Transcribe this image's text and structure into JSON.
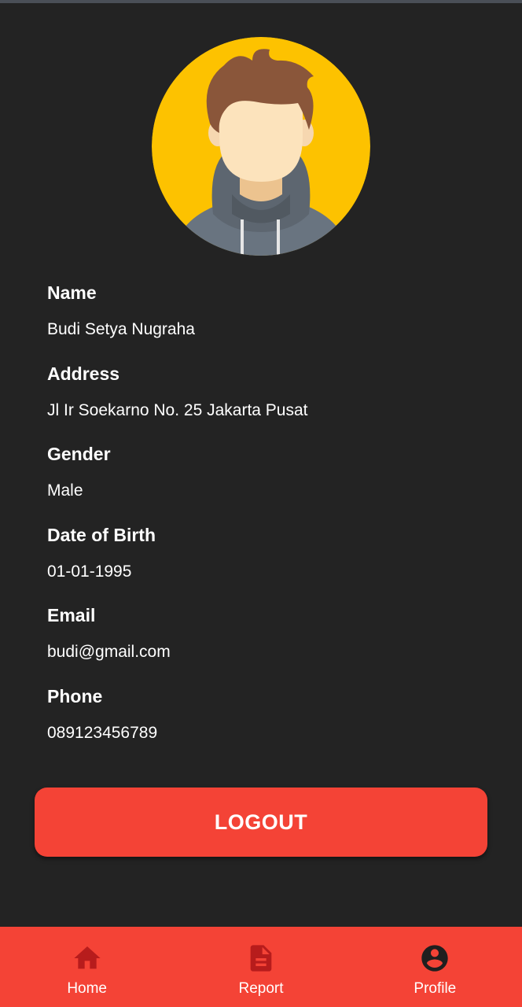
{
  "profile": {
    "fields": [
      {
        "label": "Name",
        "value": "Budi Setya Nugraha"
      },
      {
        "label": "Address",
        "value": "Jl Ir Soekarno No. 25 Jakarta Pusat"
      },
      {
        "label": "Gender",
        "value": "Male"
      },
      {
        "label": "Date of Birth",
        "value": "01-01-1995"
      },
      {
        "label": "Email",
        "value": "budi@gmail.com"
      },
      {
        "label": "Phone",
        "value": "089123456789"
      }
    ]
  },
  "actions": {
    "logout_label": "LOGOUT"
  },
  "bottom_nav": {
    "items": [
      {
        "label": "Home",
        "icon": "home-icon"
      },
      {
        "label": "Report",
        "icon": "report-icon"
      },
      {
        "label": "Profile",
        "icon": "profile-icon"
      }
    ]
  },
  "colors": {
    "background": "#232323",
    "accent": "#f44336",
    "icon_dark": "#b71c1c",
    "avatar_bg": "#fdc200"
  }
}
